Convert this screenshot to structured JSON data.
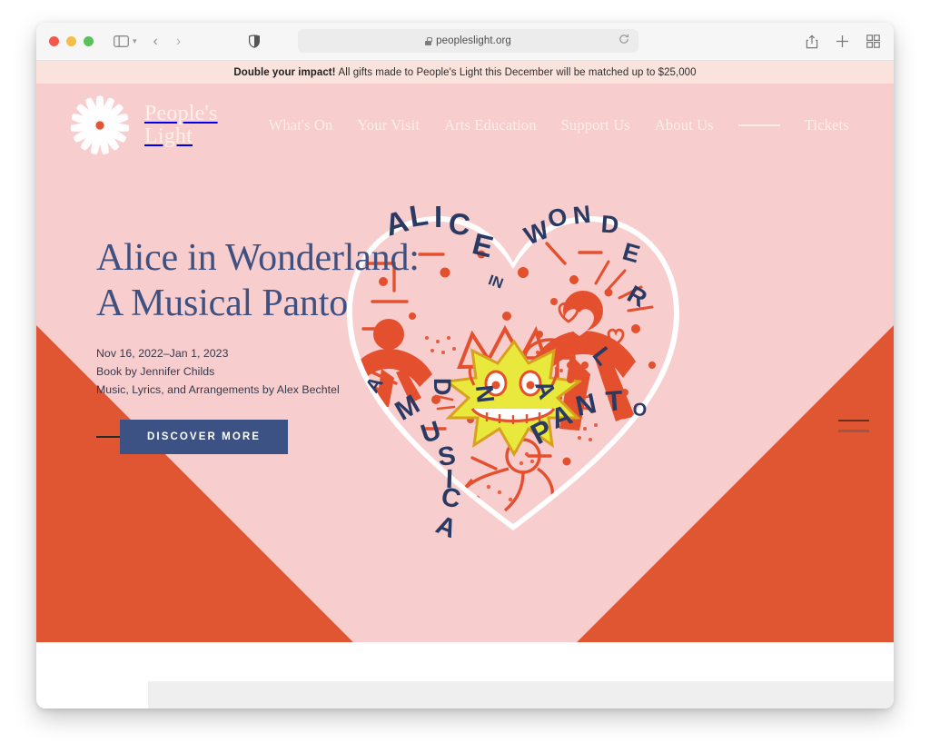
{
  "browser": {
    "url": "peopleslight.org",
    "lock_icon": "lock-icon",
    "reload_icon": "reload-icon",
    "sidebar_icon": "sidebar-icon",
    "back_icon": "chevron-left-icon",
    "forward_icon": "chevron-right-icon",
    "shield_icon": "privacy-shield-icon",
    "share_icon": "share-icon",
    "new_tab_icon": "plus-icon",
    "tab_overview_icon": "tab-grid-icon"
  },
  "banner": {
    "bold": "Double your impact!",
    "rest": "All gifts made to People's Light this December will be matched up to $25,000"
  },
  "site": {
    "brand_line1": "People's",
    "brand_line2": "Light",
    "logo_icon": "sunburst-logo-icon",
    "nav": [
      {
        "label": "What's On"
      },
      {
        "label": "Your Visit"
      },
      {
        "label": "Arts Education"
      },
      {
        "label": "Support Us"
      },
      {
        "label": "About Us"
      }
    ],
    "tickets_label": "Tickets",
    "account_icon": "person-icon",
    "search_icon": "search-icon"
  },
  "hero": {
    "title": "Alice in Wonderland:\nA Musical Panto",
    "dates": "Nov 16, 2022–Jan 1, 2023",
    "book_by": "Book by Jennifer Childs",
    "music_by": "Music, Lyrics, and Arrangements by Alex Bechtel",
    "cta_label": "DISCOVER MORE",
    "artwork": {
      "alt": "Heart-shaped doodle collage poster artwork",
      "lettering_top_left": "ALICE",
      "lettering_in": "IN",
      "lettering_top_right": "WONDERLAND",
      "lettering_a": "A",
      "lettering_musical": "MUSICAL",
      "lettering_panto": "PANTO"
    },
    "slide_indicators": 2
  },
  "colors": {
    "orange": "#e05532",
    "pink": "#f8cdcd",
    "navy": "#3e5180",
    "button_navy": "#3c5184",
    "banner_bg": "#fbe3dd",
    "cream": "#fdeeea",
    "art_red": "#e4502e",
    "art_yellow": "#e9e83c"
  }
}
